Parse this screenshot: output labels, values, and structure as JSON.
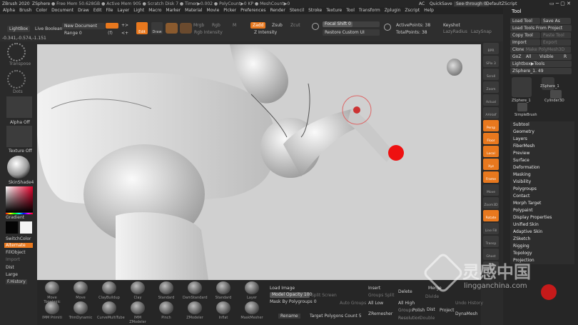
{
  "title_bar": {
    "app": "ZBrush 2020",
    "doc": "ZSphere",
    "stats": "● Free Mem 50.628GB ● Active Mem 905 ● Scratch Disk 7 ● Timer▶0.002 ● PolyCount▶0 KP ● MeshCount▶0",
    "ac": "AC",
    "quicksave": "QuickSave",
    "seethrough": "See-through  0",
    "ui_layout": "DefaultZScript"
  },
  "menu": [
    "Alpha",
    "Brush",
    "Color",
    "Document",
    "Draw",
    "Edit",
    "File",
    "Layer",
    "Light",
    "Macro",
    "Marker",
    "Material",
    "Movie",
    "Picker",
    "Preferences",
    "Render",
    "Stencil",
    "Stroke",
    "Texture",
    "Tool",
    "Transform",
    "Zplugin",
    "Zscript",
    "Help"
  ],
  "coords": "-0.341,-0.574,-1.151",
  "toolbar": {
    "lightbox": "LightBox",
    "live_boolean": "Live Boolean",
    "new_document": "New Document",
    "range": "Range 0",
    "edit": "Edit",
    "draw": "Draw",
    "mrgb": "Mrgb",
    "rgb": "Rgb",
    "m": "M",
    "zadd": "Zadd",
    "zsub": "Zsub",
    "zcut": "Zcut",
    "rgb_intensity": "Rgb Intensity",
    "z_intensity": "Z Intensity",
    "focal_shift": "Focal Shift 0",
    "restore_custom_ui": "Restore Custom UI",
    "active_points": "ActivePoints: 38",
    "total_points": "TotalPoints: 38",
    "keyshot": "Keyshot",
    "lazy_radius": "LazyRadius",
    "lazy_snap": "LazySnap"
  },
  "left_panel": {
    "transpose": "Transpose",
    "dots": "Dots",
    "alpha_off": "Alpha Off",
    "texture_off": "Texture Off",
    "skinshade": "SkinShade4",
    "gradient": "Gradient",
    "switchcolor": "SwitchColor",
    "alternate": "Alternate",
    "fillobject": "FillObject",
    "import": "Import",
    "dist": "Dist",
    "large": "Large",
    "history": "F.History"
  },
  "right_shelf": [
    "BPR",
    "SPix 3",
    "Scroll",
    "Zoom",
    "Actual",
    "AAHalf",
    "Persp",
    "Floor",
    "Local",
    "Xyz",
    "Frame",
    "Move",
    "Zoom3D",
    "Rotate",
    "Line Fill",
    "Transp",
    "Ghost",
    "Solo"
  ],
  "tool_panel": {
    "title": "Tool",
    "load_tool": "Load Tool",
    "save_as": "Save As",
    "load_tools_from_project": "Load Tools From Project",
    "copy_tool": "Copy Tool",
    "paste_tool": "Paste Tool",
    "import": "Import",
    "export": "Export",
    "clone": "Clone",
    "make_polymesh": "Make PolyMesh3D",
    "goz": "GoZ",
    "all": "All",
    "visible": "Visible",
    "r": "R",
    "lightbox_tools": "Lightbox▶Tools",
    "zsphere_value": "ZSphere_1.  49",
    "thumbs": [
      "ZSphere_1",
      "ZSphere_1",
      "Cylinder3D",
      "SimpleBrush"
    ],
    "items": [
      "Subtool",
      "Geometry",
      "Layers",
      "FiberMesh",
      "Preview",
      "Surface",
      "Deformation",
      "Masking",
      "Visibility",
      "Polygroups",
      "Contact",
      "Morph Target",
      "Polypaint",
      "Display Properties",
      "Unified Skin",
      "Adaptive Skin",
      "ZSketch",
      "Rigging",
      "Topology",
      "Projection"
    ]
  },
  "bottom": {
    "brushes_row1": [
      "Move Topologic",
      "Move",
      "ClayBuildup",
      "Clay",
      "Standard",
      "DamStandard",
      "Standard",
      "Layer"
    ],
    "brushes_row2": [
      "IMM Primiti",
      "TrimDynamic",
      "CurveMultiTube",
      "IMM ZModeler",
      "Pinch",
      "ZModeler",
      "Inflat",
      "MaskMesher"
    ],
    "load_image": "Load Image",
    "model_opacity": "Model Opacity 100",
    "split_screen": "Split Screen",
    "mask_by_polygroups": "Mask By Polygroups 0",
    "insert": "Insert",
    "groups_split": "Groups Split",
    "delete": "Delete",
    "all_low": "All Low",
    "all_high": "All High",
    "divide": "Divide",
    "rename": "Rename",
    "target_polygons": "Target Polygons Count 5",
    "zremesher": "ZRemesher",
    "groups": "Groups",
    "polish": "Polish",
    "dist": "Dist",
    "project": "Project",
    "merge": "Merge",
    "auto_groups": "Auto Groups",
    "double": "Double",
    "resolution": "Resolution",
    "dynamesh": "DynaMesh",
    "undo_history": "Undo History"
  },
  "watermark": {
    "cn": "灵感中国",
    "url": "lingganchina.com"
  },
  "colors": {
    "accent": "#e8781e",
    "canvas": "#d0d0d0"
  }
}
